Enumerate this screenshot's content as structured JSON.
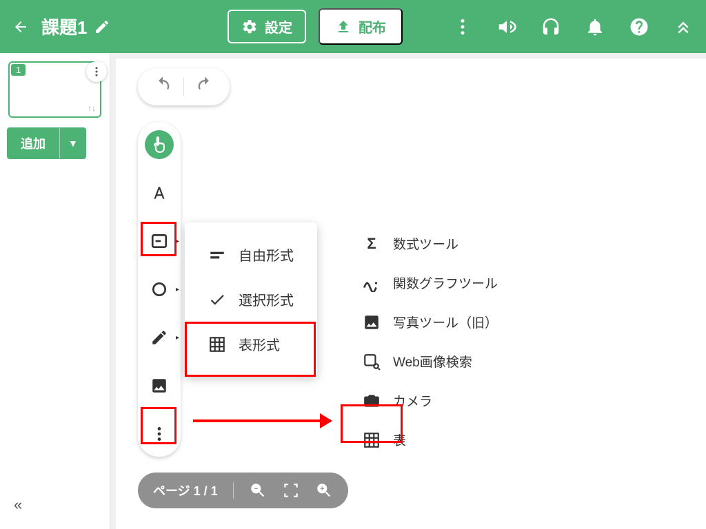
{
  "header": {
    "title": "課題1",
    "settings_label": "設定",
    "distribute_label": "配布"
  },
  "sidebar": {
    "thumb_page": "1",
    "add_label": "追加"
  },
  "toolbar": {
    "tools": [
      "pointer",
      "text",
      "card",
      "shape",
      "pen",
      "image",
      "more"
    ]
  },
  "flyout1": {
    "items": [
      {
        "icon": "freeform",
        "label": "自由形式"
      },
      {
        "icon": "check",
        "label": "選択形式"
      },
      {
        "icon": "table-edit",
        "label": "表形式"
      }
    ]
  },
  "flyout2": {
    "items": [
      {
        "icon": "sigma",
        "label": "数式ツール"
      },
      {
        "icon": "function",
        "label": "関数グラフツール"
      },
      {
        "icon": "photo",
        "label": "写真ツール（旧）"
      },
      {
        "icon": "websearch",
        "label": "Web画像検索"
      },
      {
        "icon": "camera",
        "label": "カメラ"
      },
      {
        "icon": "table",
        "label": "表"
      }
    ]
  },
  "bottom": {
    "page_label": "ページ 1 / 1"
  }
}
